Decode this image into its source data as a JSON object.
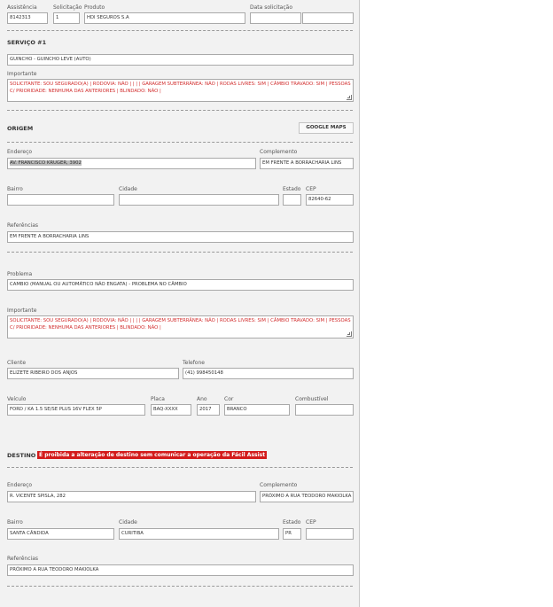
{
  "top": {
    "assistencia_label": "Assistência",
    "assistencia_value": "8142313",
    "solicitacao_label": "Solicitação",
    "solicitacao_value": "1",
    "produto_label": "Produto",
    "produto_value": "HDI SEGUROS S.A",
    "data_label": "Data solicitação",
    "data_value": "",
    "data_value2": ""
  },
  "servico": {
    "title": "SERVIÇO #1",
    "servico_value": "GUINCHO - GUINCHO LEVE (AUTO)",
    "importante_label": "Importante",
    "importante_value": "SOLICITANTE: SOU SEGURADO(A) | RODOVIA: NÃO | | | | GARAGEM SUBTERRÂNEA: NÃO | RODAS LIVRES: SIM | CÂMBIO TRAVADO: SIM | PESSOAS C/ PRIORIDADE: NENHUMA DAS ANTERIORES | BLINDADO: NÃO |"
  },
  "origem": {
    "title": "ORIGEM",
    "maps_button": "GOOGLE MAPS",
    "endereco_label": "Endereço",
    "endereco_value": "AV. FRANCISCO KRUGER, 3902",
    "complemento_label": "Complemento",
    "complemento_value": "EM FRENTE A BORRACHARIA LINS",
    "bairro_label": "Bairro",
    "bairro_value": "",
    "cidade_label": "Cidade",
    "cidade_value": "",
    "estado_label": "Estado",
    "estado_value": "",
    "cep_label": "CEP",
    "cep_value": "82640-62",
    "referencias_label": "Referências",
    "referencias_value": "EM FRENTE A BORRACHARIA LINS"
  },
  "problema": {
    "label": "Problema",
    "value": "CAMBIO (MANUAL OU AUTOMÁTICO NÃO ENGATA) - PROBLEMA NO CÂMBIO",
    "importante_label": "Importante",
    "importante_value": "SOLICITANTE: SOU SEGURADO(A) | RODOVIA: NÃO | | | | GARAGEM SUBTERRÂNEA: NÃO | RODAS LIVRES: SIM | CÂMBIO TRAVADO: SIM | PESSOAS C/ PRIORIDADE: NENHUMA DAS ANTERIORES | BLINDADO: NÃO |"
  },
  "cliente": {
    "label": "Cliente",
    "value": "ELIZETE RIBEIRO DOS ANJOS",
    "telefone_label": "Telefone",
    "telefone_value": "(41) 998450148"
  },
  "veiculo": {
    "veiculo_label": "Veículo",
    "veiculo_value": "FORD / KA 1.5 SE/SE PLUS 16V FLEX 5P",
    "placa_label": "Placa",
    "placa_value": "BAQ-XXXX",
    "ano_label": "Ano",
    "ano_value": "2017",
    "cor_label": "Cor",
    "cor_value": "BRANCO",
    "combustivel_label": "Combustível",
    "combustivel_value": ""
  },
  "destino": {
    "title": "DESTINO",
    "warning": "É proibida a alteração de destino sem comunicar a operação da Fácil Assist",
    "endereco_label": "Endereço",
    "endereco_value": "R. VICENTE SPISLA, 282",
    "complemento_label": "Complemento",
    "complemento_value": "PRÓXIMO A RUA TEODORO MAKIOLKA",
    "bairro_label": "Bairro",
    "bairro_value": "SANTA CÂNDIDA",
    "cidade_label": "Cidade",
    "cidade_value": "CURITIBA",
    "estado_label": "Estado",
    "estado_value": "PR",
    "cep_label": "CEP",
    "cep_value": "",
    "referencias_label": "Referências",
    "referencias_value": "PRÓXIMO A RUA TEODORO MAKIOLKA"
  },
  "colors": {
    "warning_bg": "#d31b1b",
    "important_text": "#d12b2b",
    "panel_bg": "#f2f2f2"
  }
}
